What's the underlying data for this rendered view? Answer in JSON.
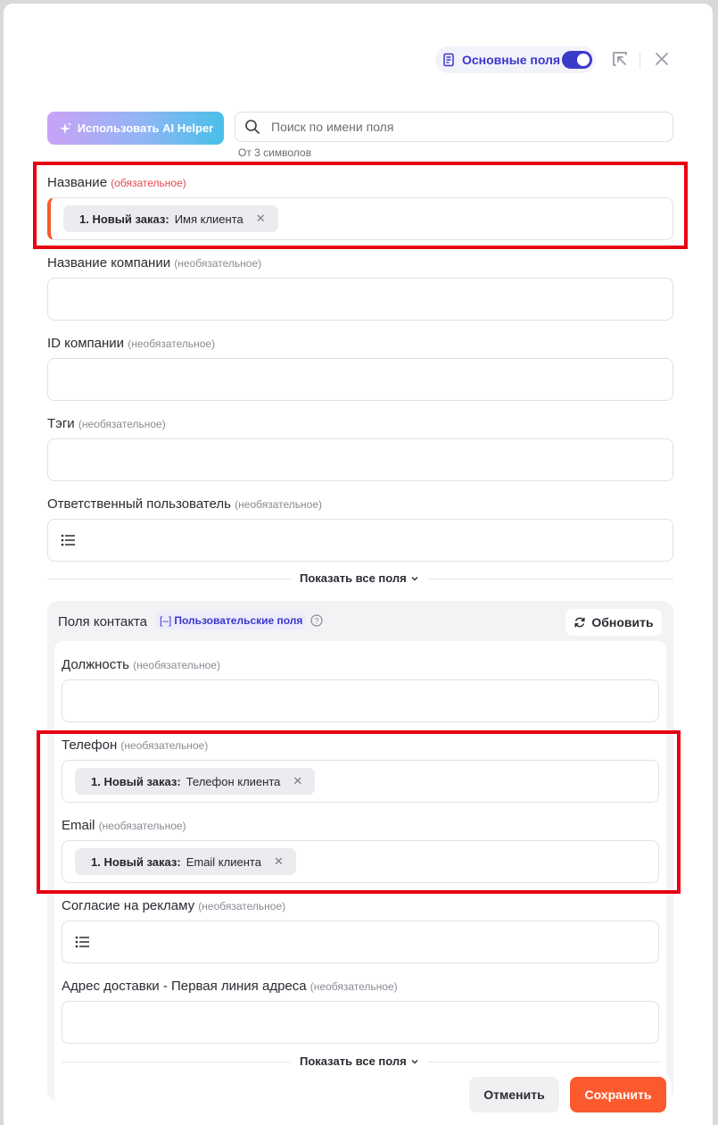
{
  "header": {
    "toggle_label": "Основные поля",
    "toggle_on": true
  },
  "toolbar": {
    "ai_button_label": "Использовать AI Helper",
    "search_placeholder": "Поиск по имени поля",
    "search_hint": "От 3 символов"
  },
  "fields": {
    "name": {
      "label": "Название",
      "tag": "(обязательное)",
      "chip_source": "1. Новый заказ:",
      "chip_value": "Имя клиента"
    },
    "company_name": {
      "label": "Название компании",
      "tag": "(необязательное)"
    },
    "company_id": {
      "label": "ID компании",
      "tag": "(необязательное)"
    },
    "tags": {
      "label": "Тэги",
      "tag": "(необязательное)"
    },
    "owner": {
      "label": "Ответственный пользователь",
      "tag": "(необязательное)"
    }
  },
  "show_all_label": "Показать все поля",
  "contact": {
    "title": "Поля контакта",
    "badge": "Пользовательские поля",
    "refresh_label": "Обновить",
    "fields": {
      "position": {
        "label": "Должность",
        "tag": "(необязательное)"
      },
      "phone": {
        "label": "Телефон",
        "tag": "(необязательное)",
        "chip_source": "1. Новый заказ:",
        "chip_value": "Телефон клиента"
      },
      "email": {
        "label": "Email",
        "tag": "(необязательное)",
        "chip_source": "1. Новый заказ:",
        "chip_value": "Email клиента"
      },
      "ads_consent": {
        "label": "Согласие на рекламу",
        "tag": "(необязательное)"
      },
      "address": {
        "label": "Адрес доставки - Первая линия адреса",
        "tag": "(необязательное)"
      }
    },
    "show_all_label": "Показать все поля"
  },
  "footer": {
    "cancel_label": "Отменить",
    "save_label": "Сохранить"
  },
  "colors": {
    "accent": "#3b36c9",
    "save": "#fb5a2e",
    "required": "#e5484d",
    "highlight_box": "#e60012"
  }
}
